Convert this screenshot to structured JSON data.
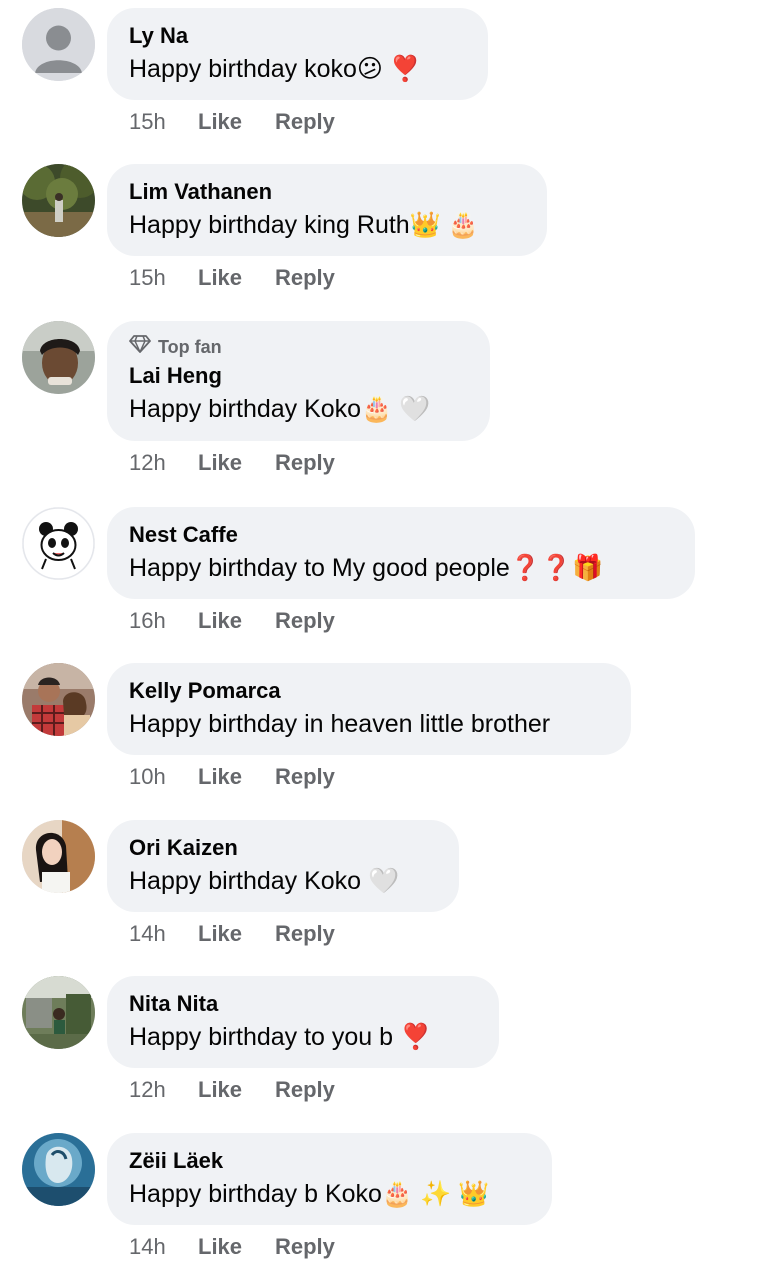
{
  "comments": [
    {
      "name": "Ly Na",
      "text": "Happy birthday koko😕 ❣️",
      "time": "15h",
      "like_label": "Like",
      "reply_label": "Reply",
      "avatar": "default-avatar-icon",
      "top_fan": false
    },
    {
      "name": "Lim Vathanen",
      "text": "Happy birthday king Ruth👑 🎂",
      "time": "15h",
      "like_label": "Like",
      "reply_label": "Reply",
      "avatar": "forest-photo",
      "top_fan": false
    },
    {
      "name": "Lai Heng",
      "text": "Happy birthday Koko🎂 🤍",
      "time": "12h",
      "like_label": "Like",
      "reply_label": "Reply",
      "avatar": "person-photo",
      "top_fan": true,
      "badge_label": "Top fan"
    },
    {
      "name": "Nest Caffe",
      "text": "Happy birthday to  My good people❓❓🎁",
      "time": "16h",
      "like_label": "Like",
      "reply_label": "Reply",
      "avatar": "panda-cartoon",
      "top_fan": false
    },
    {
      "name": "Kelly Pomarca",
      "text": "Happy birthday in heaven little brother",
      "time": "10h",
      "like_label": "Like",
      "reply_label": "Reply",
      "avatar": "couple-photo",
      "top_fan": false
    },
    {
      "name": "Ori Kaizen",
      "text": "Happy birthday Koko 🤍",
      "time": "14h",
      "like_label": "Like",
      "reply_label": "Reply",
      "avatar": "woman-photo",
      "top_fan": false
    },
    {
      "name": "Nita Nita",
      "text": "Happy birthday to you b  ❣️",
      "time": "12h",
      "like_label": "Like",
      "reply_label": "Reply",
      "avatar": "garden-photo",
      "top_fan": false
    },
    {
      "name": "Zëii Läek",
      "text": "Happy birthday b Koko🎂 ✨ 👑",
      "time": "14h",
      "like_label": "Like",
      "reply_label": "Reply",
      "avatar": "blue-art-photo",
      "top_fan": false
    }
  ],
  "colors": {
    "bubble_bg": "#f0f2f5",
    "primary_text": "#050505",
    "secondary_text": "#65676b"
  }
}
